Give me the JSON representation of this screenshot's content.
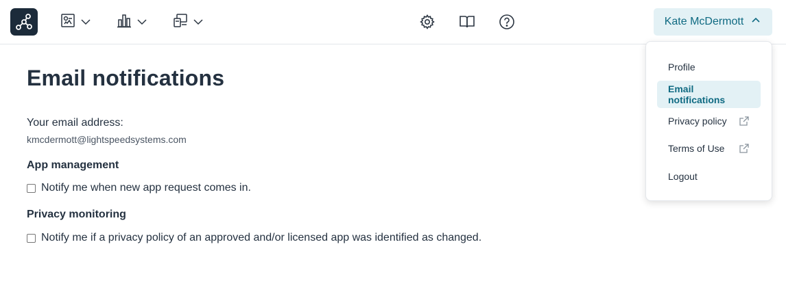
{
  "header": {
    "logo_icon": "network-graph-icon",
    "nav": [
      {
        "icon": "app-catalog-icon",
        "chevron": "chevron-down-icon"
      },
      {
        "icon": "bar-chart-icon",
        "chevron": "chevron-down-icon"
      },
      {
        "icon": "devices-icon",
        "chevron": "chevron-down-icon"
      }
    ],
    "settings_icon": "gear-icon",
    "docs_icon": "book-icon",
    "help_icon": "question-icon",
    "user_name": "Kate McDermott",
    "user_chevron": "chevron-up-icon"
  },
  "page": {
    "title": "Email notifications",
    "email_label": "Your email address:",
    "email_value": "kmcdermott@lightspeedsystems.com",
    "sections": [
      {
        "heading": "App management",
        "checkbox_label": "Notify me when new app request comes in.",
        "checked": false
      },
      {
        "heading": "Privacy monitoring",
        "checkbox_label": "Notify me if a privacy policy of an approved and/or licensed app was identified as changed.",
        "checked": false
      }
    ]
  },
  "user_menu": {
    "items": [
      {
        "label": "Profile",
        "active": false,
        "external": false
      },
      {
        "label": "Email notifications",
        "active": true,
        "external": false
      },
      {
        "label": "Privacy policy",
        "active": false,
        "external": true
      },
      {
        "label": "Terms of Use",
        "active": false,
        "external": true
      },
      {
        "label": "Logout",
        "active": false,
        "external": false
      }
    ]
  },
  "colors": {
    "logo_bg": "#1c2b3a",
    "accent": "#0f6a82",
    "accent_bg": "#e3f1f5",
    "text": "#243140"
  }
}
